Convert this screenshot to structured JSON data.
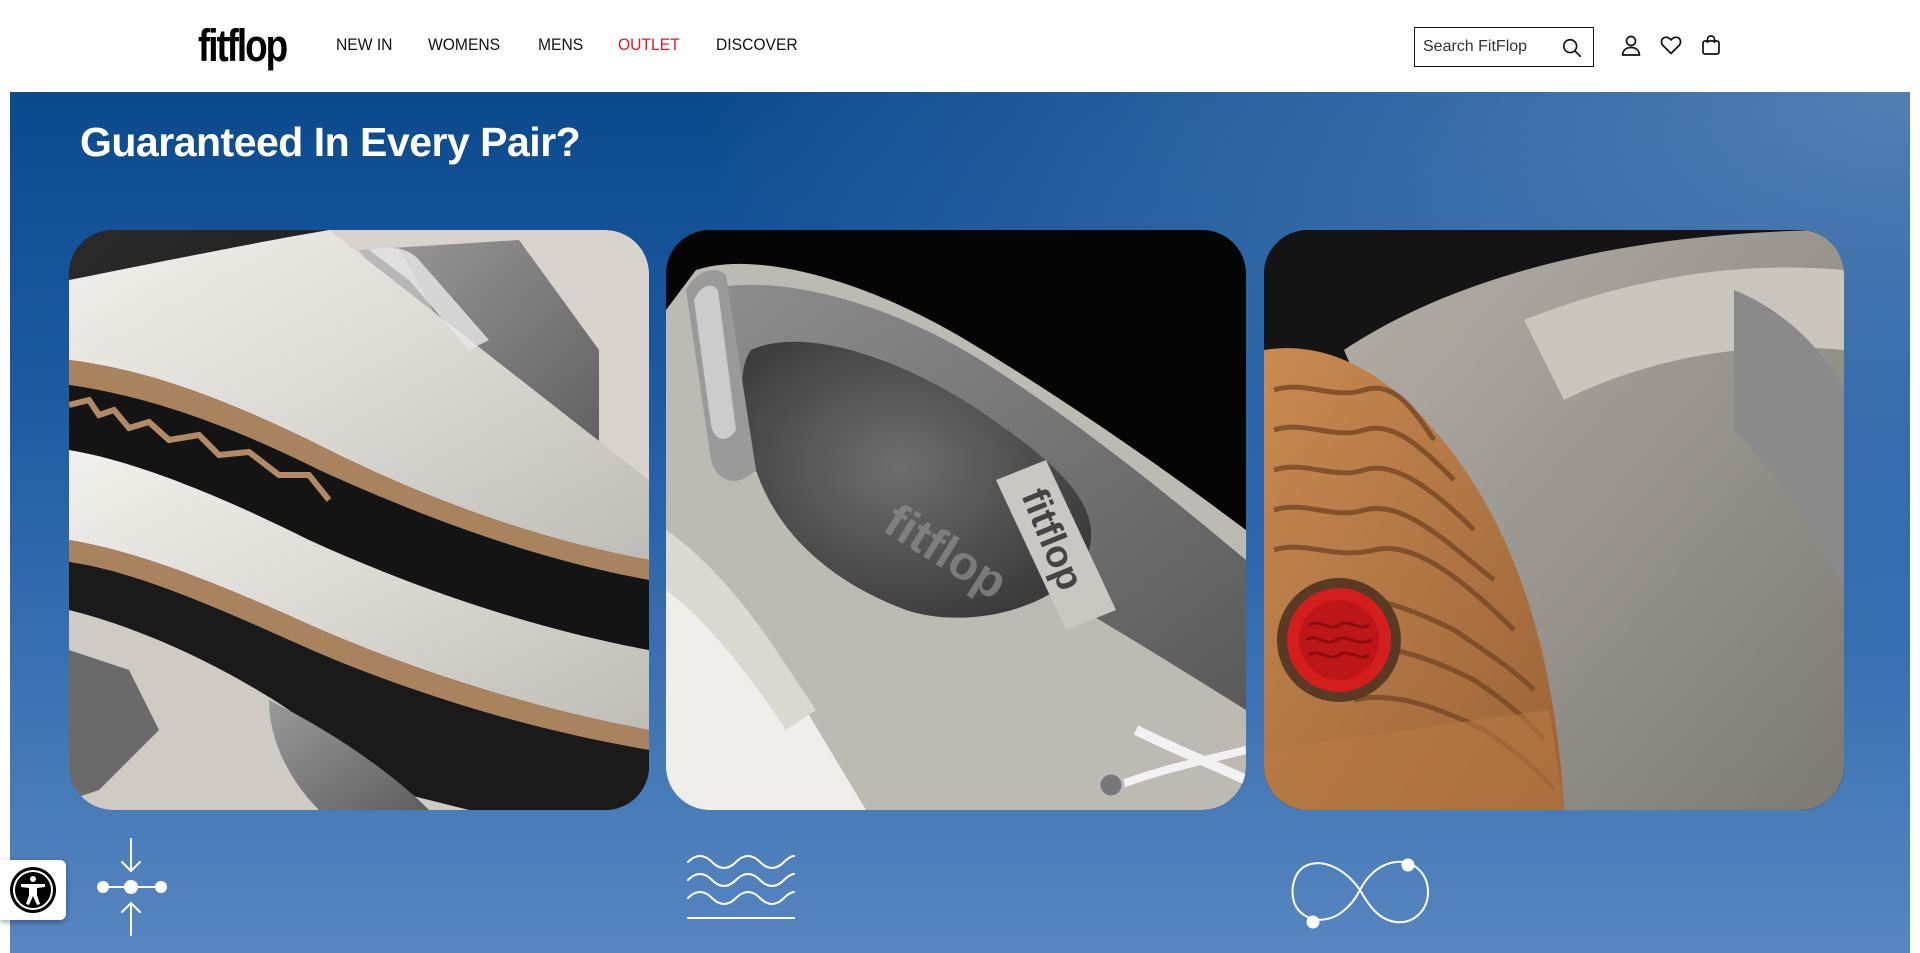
{
  "header": {
    "logo": "fitflop",
    "nav": [
      {
        "label": "NEW IN"
      },
      {
        "label": "WOMENS"
      },
      {
        "label": "MENS"
      },
      {
        "label": "OUTLET"
      },
      {
        "label": "DISCOVER"
      }
    ],
    "search": {
      "placeholder": "Search FitFlop"
    }
  },
  "hero": {
    "title": "Guaranteed In Every Pair?",
    "cards": [
      {
        "image": "sneaker-sole-layers"
      },
      {
        "image": "sneaker-insole-heel"
      },
      {
        "image": "sneaker-outsole-tread"
      }
    ],
    "features": [
      {
        "icon": "compression-arrows-icon"
      },
      {
        "icon": "waves-icon"
      },
      {
        "icon": "infinity-icon"
      }
    ]
  },
  "colors": {
    "accent_outlet": "#e0171f",
    "hero_blue": "#1d5aa0"
  }
}
